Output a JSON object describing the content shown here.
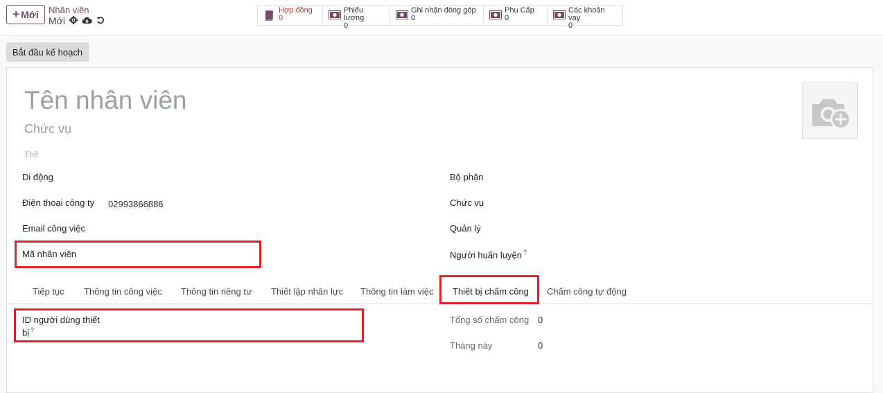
{
  "topbar": {
    "new_label": "Mới",
    "breadcrumb_parent": "Nhân viên",
    "breadcrumb_current": "Mới"
  },
  "smart_buttons": [
    {
      "label": "Hợp đồng",
      "value": "0",
      "icon": "book-icon"
    },
    {
      "label": "Phiếu lương",
      "value": "0",
      "icon": "money-icon"
    },
    {
      "label": "Ghi nhận đóng góp",
      "value": "0",
      "icon": "money-icon"
    },
    {
      "label": "Phụ Cấp",
      "value": "0",
      "icon": "money-icon"
    },
    {
      "label": "Các khoản vay",
      "value": "0",
      "icon": "money-icon"
    }
  ],
  "plan_button": "Bắt đầu kế hoạch",
  "form": {
    "name_placeholder": "Tên nhân viên",
    "job_placeholder": "Chức vụ",
    "tags_placeholder": "Thẻ",
    "left_fields": {
      "mobile": "Di động",
      "work_phone": "Điện thoại công ty",
      "work_phone_value": "02993866886",
      "work_email": "Email công việc",
      "employee_code": "Mã nhân viên"
    },
    "right_fields": {
      "department": "Bộ phận",
      "job_position": "Chức vụ",
      "manager": "Quản lý",
      "coach": "Người huấn luyện",
      "coach_help": "?"
    }
  },
  "tabs": [
    "Tiếp tục",
    "Thông tin công việc",
    "Thông tin riêng tư",
    "Thiết lập nhân lực",
    "Thông tin làm việc",
    "Thiết bị chấm công",
    "Chấm công tự động"
  ],
  "tab_content": {
    "device_user_id_line1": "ID người dùng thiết",
    "device_user_id_line2": "bị",
    "help_mark": "?",
    "total_attendance_label": "Tổng số chấm công",
    "total_attendance_value": "0",
    "this_month_label": "Tháng này",
    "this_month_value": "0"
  },
  "colors": {
    "brand": "#714b67",
    "highlight": "#e0202a",
    "contract_red": "#c0392b"
  }
}
